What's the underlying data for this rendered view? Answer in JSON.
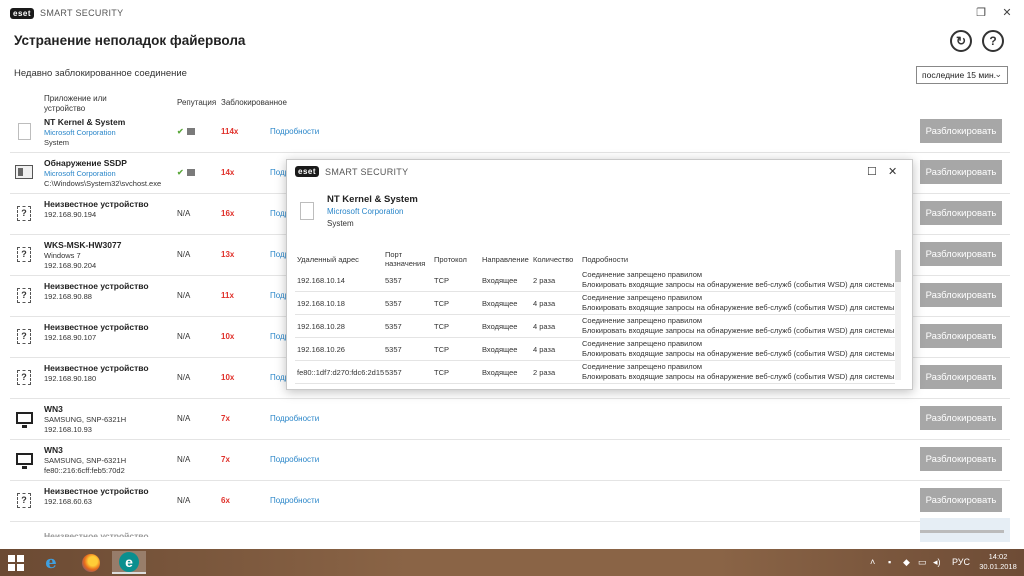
{
  "window": {
    "logo": "eset",
    "brand": "SMART SECURITY",
    "restore_icon": "restore-icon",
    "close_icon": "close-icon"
  },
  "page": {
    "title": "Устранение неполадок файервола",
    "subtitle": "Недавно заблокированное соединение",
    "refresh_icon": "refresh-icon",
    "help_icon": "help-icon",
    "help_glyph": "?",
    "period_selected": "последние 15 мин."
  },
  "columns": {
    "app": "Приложение или",
    "app2": "устройство",
    "reputation": "Репутация",
    "blocked": "Заблокированное"
  },
  "rows": [
    {
      "icon": "document-icon",
      "name": "NT Kernel & System",
      "sub1": "Microsoft Corporation",
      "sub2": "System",
      "rep": "✔",
      "blocked": "114x",
      "details": "Подробности",
      "button": "Разблокировать"
    },
    {
      "icon": "service-icon",
      "name": "Обнаружение SSDP",
      "sub1": "Microsoft Corporation",
      "sub2": "C:\\Windows\\System32\\svchost.exe",
      "rep": "✔",
      "blocked": "14x",
      "details": "Подробности",
      "button": "Разблокировать"
    },
    {
      "icon": "unknown-device-icon",
      "name": "Неизвестное устройство",
      "sub1": "192.168.90.194",
      "sub2": "",
      "rep": "N/A",
      "blocked": "16x",
      "details": "Подробности",
      "button": "Разблокировать"
    },
    {
      "icon": "unknown-device-icon",
      "name": "WKS-MSK-HW3077",
      "sub1": "Windows 7",
      "sub2": "192.168.90.204",
      "rep": "N/A",
      "blocked": "13x",
      "details": "Подробности",
      "button": "Разблокировать"
    },
    {
      "icon": "unknown-device-icon",
      "name": "Неизвестное устройство",
      "sub1": "192.168.90.88",
      "sub2": "",
      "rep": "N/A",
      "blocked": "11x",
      "details": "Подробности",
      "button": "Разблокировать"
    },
    {
      "icon": "unknown-device-icon",
      "name": "Неизвестное устройство",
      "sub1": "192.168.90.107",
      "sub2": "",
      "rep": "N/A",
      "blocked": "10x",
      "details": "Подробности",
      "button": "Разблокировать"
    },
    {
      "icon": "unknown-device-icon",
      "name": "Неизвестное устройство",
      "sub1": "192.168.90.180",
      "sub2": "",
      "rep": "N/A",
      "blocked": "10x",
      "details": "Подробности",
      "button": "Разблокировать"
    },
    {
      "icon": "monitor-icon",
      "name": "WN3",
      "sub1": "SAMSUNG, SNP-6321H",
      "sub2": "192.168.10.93",
      "rep": "N/A",
      "blocked": "7x",
      "details": "Подробности",
      "button": "Разблокировать"
    },
    {
      "icon": "monitor-icon",
      "name": "WN3",
      "sub1": "SAMSUNG, SNP-6321H",
      "sub2": "fe80::216:6cff:feb5:70d2",
      "rep": "N/A",
      "blocked": "7x",
      "details": "Подробности",
      "button": "Разблокировать"
    },
    {
      "icon": "unknown-device-icon",
      "name": "Неизвестное устройство",
      "sub1": "192.168.60.63",
      "sub2": "",
      "rep": "N/A",
      "blocked": "6x",
      "details": "Подробности",
      "button": "Разблокировать"
    }
  ],
  "partial_row": "Неизвестное устройство",
  "popup": {
    "logo": "eset",
    "brand": "SMART SECURITY",
    "maximize_icon": "maximize-icon",
    "close_icon": "close-icon",
    "app_name": "NT Kernel & System",
    "app_company": "Microsoft Corporation",
    "app_path": "System",
    "headers": {
      "remote": "Удаленный адрес",
      "port1": "Порт",
      "port2": "назначения",
      "protocol": "Протокол",
      "direction": "Направление",
      "count": "Количество",
      "details": "Подробности"
    },
    "rows": [
      {
        "addr": "192.168.10.14",
        "port": "5357",
        "proto": "TCP",
        "dir": "Входящее",
        "count": "2 раза",
        "d1": "Соединение запрещено правилом",
        "d2": "Блокировать входящие запросы на обнаружение веб-служб (события WSD) для системы"
      },
      {
        "addr": "192.168.10.18",
        "port": "5357",
        "proto": "TCP",
        "dir": "Входящее",
        "count": "4 раза",
        "d1": "Соединение запрещено правилом",
        "d2": "Блокировать входящие запросы на обнаружение веб-служб (события WSD) для системы"
      },
      {
        "addr": "192.168.10.28",
        "port": "5357",
        "proto": "TCP",
        "dir": "Входящее",
        "count": "4 раза",
        "d1": "Соединение запрещено правилом",
        "d2": "Блокировать входящие запросы на обнаружение веб-служб (события WSD) для системы"
      },
      {
        "addr": "192.168.10.26",
        "port": "5357",
        "proto": "TCP",
        "dir": "Входящее",
        "count": "4 раза",
        "d1": "Соединение запрещено правилом",
        "d2": "Блокировать входящие запросы на обнаружение веб-служб (события WSD) для системы"
      },
      {
        "addr": "fe80::1df7:d270:fdc6:2d15",
        "port": "5357",
        "proto": "TCP",
        "dir": "Входящее",
        "count": "2 раза",
        "d1": "Соединение запрещено правилом",
        "d2": "Блокировать входящие запросы на обнаружение веб-служб (события WSD) для системы"
      }
    ]
  },
  "taskbar": {
    "start_icon": "windows-start-icon",
    "apps": [
      "internet-explorer-icon",
      "firefox-icon",
      "eset-icon"
    ],
    "ie_glyph": "e",
    "eset_glyph": "e",
    "lang": "РУС",
    "time": "14:02",
    "date": "30.01.2018"
  }
}
